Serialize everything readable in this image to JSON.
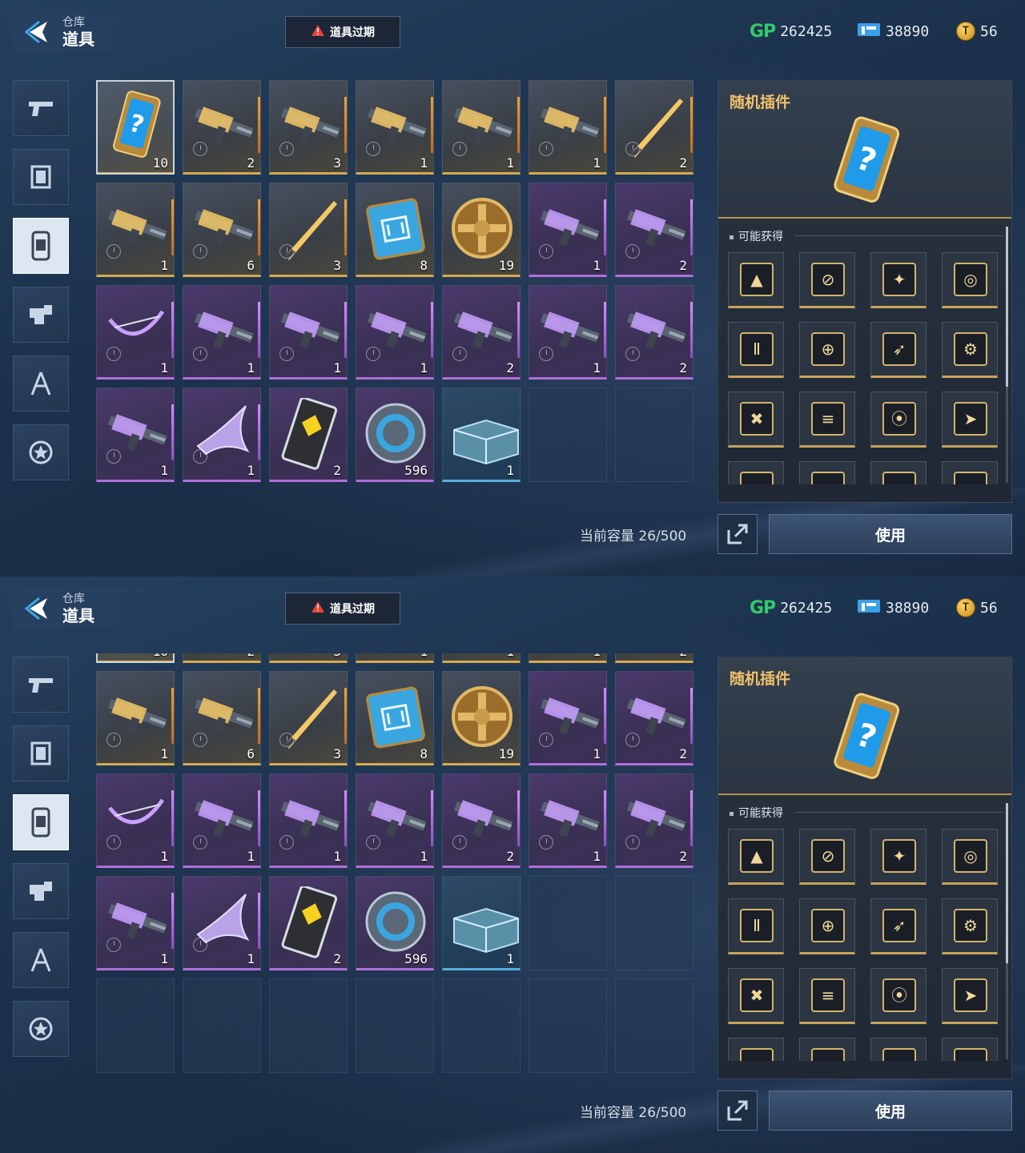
{
  "header": {
    "breadcrumb_parent": "仓库",
    "title": "道具",
    "expire_button_label": "道具过期"
  },
  "currencies": [
    {
      "icon": "gp-icon",
      "symbol": "GP",
      "value": "262425",
      "color": "#32c96b"
    },
    {
      "icon": "ticket-icon",
      "value": "38890",
      "color": "#3aa0e8"
    },
    {
      "icon": "gold-coin-icon",
      "value": "56",
      "color": "#e3a629"
    }
  ],
  "side_tabs": [
    {
      "name": "weapons",
      "icon": "pistol-icon"
    },
    {
      "name": "frames",
      "icon": "frame-icon"
    },
    {
      "name": "items",
      "icon": "item-card-icon",
      "active": true
    },
    {
      "name": "parts",
      "icon": "gear-block-icon"
    },
    {
      "name": "tools",
      "icon": "compass-icon"
    },
    {
      "name": "badges",
      "icon": "star-badge-icon"
    }
  ],
  "inventory": {
    "items": [
      {
        "rarity": "gold",
        "kind": "card",
        "qty": "10",
        "selected": true
      },
      {
        "rarity": "gold",
        "kind": "gun",
        "qty": "2"
      },
      {
        "rarity": "gold",
        "kind": "gun",
        "qty": "3"
      },
      {
        "rarity": "gold",
        "kind": "gun",
        "qty": "1"
      },
      {
        "rarity": "gold",
        "kind": "gun",
        "qty": "1"
      },
      {
        "rarity": "gold",
        "kind": "gun",
        "qty": "1"
      },
      {
        "rarity": "gold",
        "kind": "blade",
        "qty": "2"
      },
      {
        "rarity": "gold",
        "kind": "gun",
        "qty": "1"
      },
      {
        "rarity": "gold",
        "kind": "gun",
        "qty": "6"
      },
      {
        "rarity": "gold",
        "kind": "blade",
        "qty": "3"
      },
      {
        "rarity": "gold",
        "kind": "chip",
        "qty": "8"
      },
      {
        "rarity": "gold",
        "kind": "coin",
        "qty": "19"
      },
      {
        "rarity": "purple",
        "kind": "gun",
        "qty": "1"
      },
      {
        "rarity": "purple",
        "kind": "gun",
        "qty": "2"
      },
      {
        "rarity": "purple",
        "kind": "bow",
        "qty": "1"
      },
      {
        "rarity": "purple",
        "kind": "gun",
        "qty": "1"
      },
      {
        "rarity": "purple",
        "kind": "gun",
        "qty": "1"
      },
      {
        "rarity": "purple",
        "kind": "gun",
        "qty": "1"
      },
      {
        "rarity": "purple",
        "kind": "gun",
        "qty": "2"
      },
      {
        "rarity": "purple",
        "kind": "gun",
        "qty": "1"
      },
      {
        "rarity": "purple",
        "kind": "gun",
        "qty": "2"
      },
      {
        "rarity": "purple",
        "kind": "gun",
        "qty": "1"
      },
      {
        "rarity": "purple",
        "kind": "wing",
        "qty": "1"
      },
      {
        "rarity": "purple",
        "kind": "tag",
        "qty": "2"
      },
      {
        "rarity": "purple",
        "kind": "ring",
        "qty": "596"
      },
      {
        "rarity": "blue",
        "kind": "crate",
        "qty": "1"
      }
    ],
    "capacity_label": "当前容量 26/500"
  },
  "detail": {
    "title": "随机插件",
    "obtain_label": "可能获得",
    "possible_rewards": [
      "▲",
      "⊘",
      "✦",
      "◎",
      "Ⅱ",
      "⊕",
      "➶",
      "⚙",
      "✖",
      "≡",
      "⦿",
      "➤",
      "·",
      "·",
      "·",
      "·"
    ]
  },
  "actions": {
    "use_label": "使用",
    "share_icon": "expand-icon"
  },
  "colors": {
    "rarity_gold": "#d5a94f",
    "rarity_purple": "#b06fd9",
    "rarity_blue": "#58aee0",
    "panel_title": "#f1c16a"
  }
}
